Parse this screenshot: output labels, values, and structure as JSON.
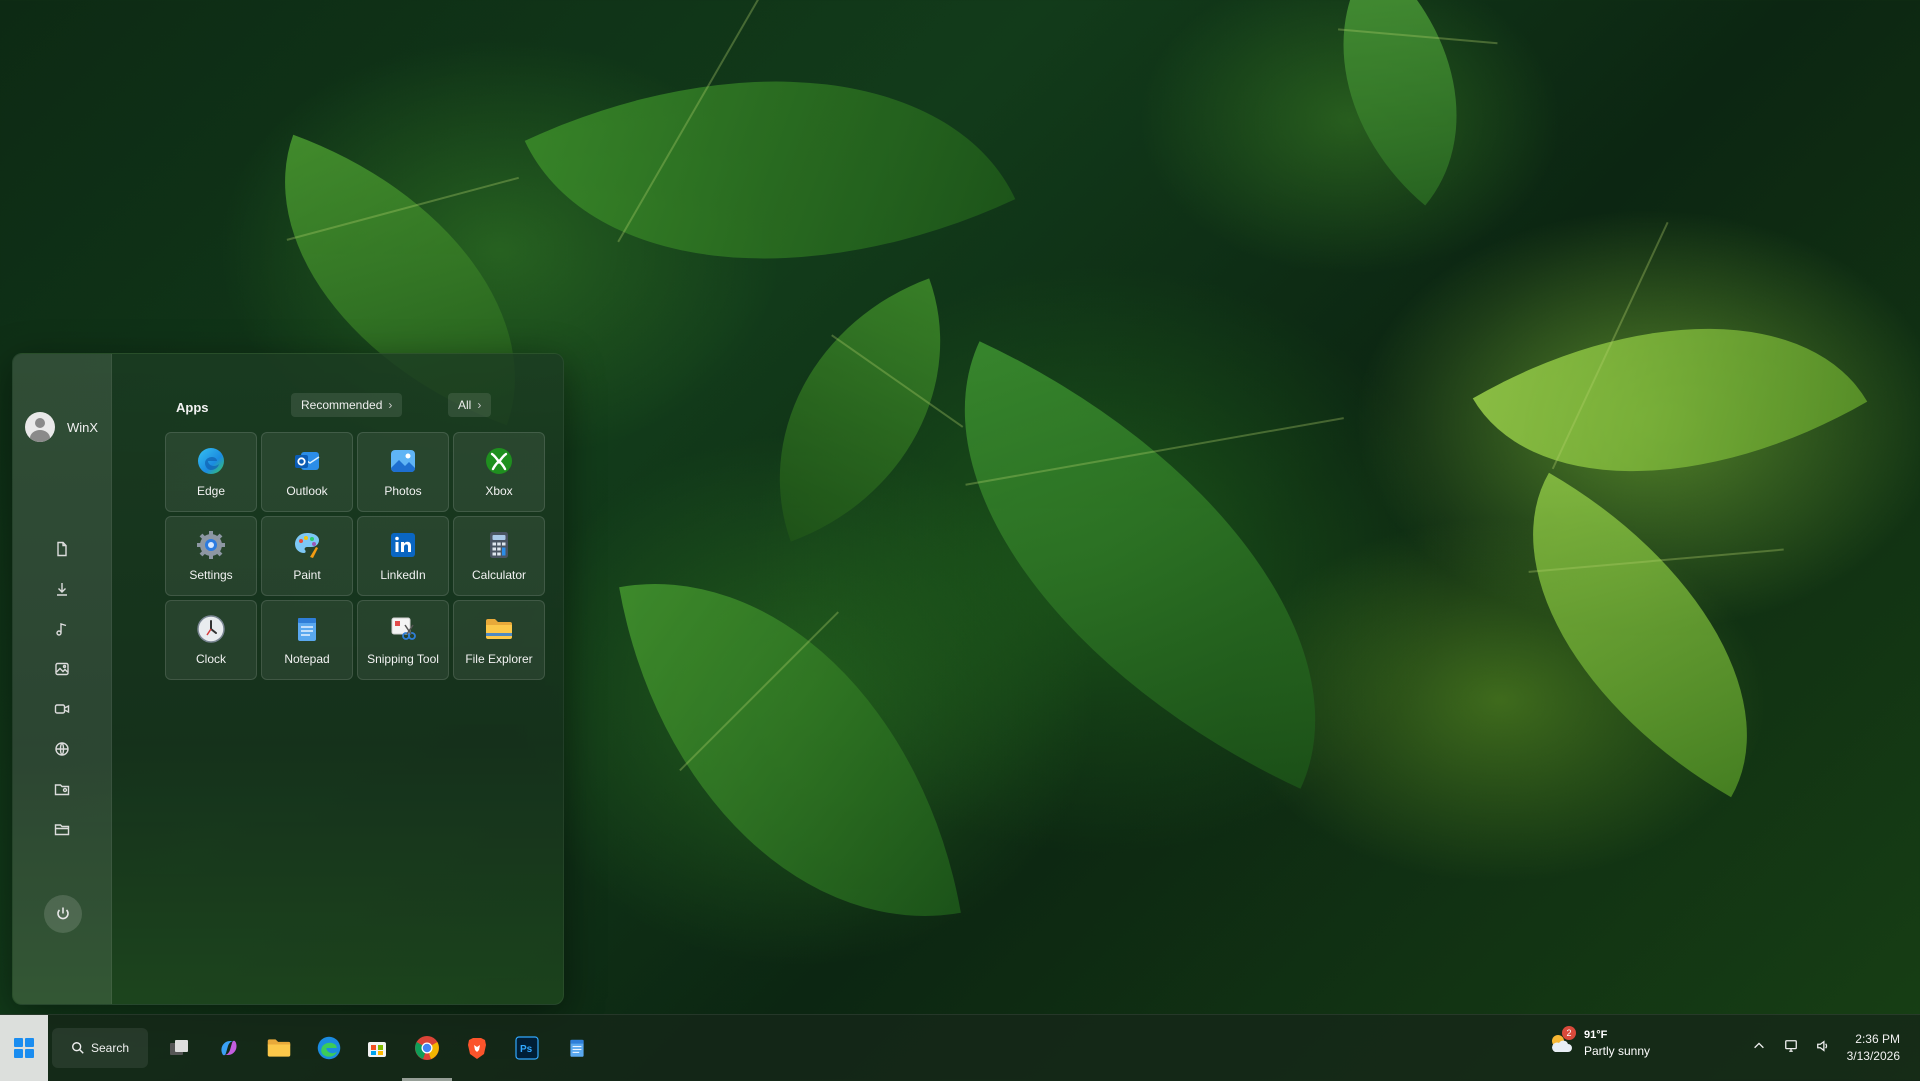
{
  "start_menu": {
    "user": {
      "name": "WinX"
    },
    "apps_heading": "Apps",
    "recommended_label": "Recommended",
    "all_label": "All",
    "apps": [
      {
        "label": "Edge",
        "icon": "edge-icon"
      },
      {
        "label": "Outlook",
        "icon": "outlook-icon"
      },
      {
        "label": "Photos",
        "icon": "photos-icon"
      },
      {
        "label": "Xbox",
        "icon": "xbox-icon"
      },
      {
        "label": "Settings",
        "icon": "settings-icon"
      },
      {
        "label": "Paint",
        "icon": "paint-icon"
      },
      {
        "label": "LinkedIn",
        "icon": "linkedin-icon"
      },
      {
        "label": "Calculator",
        "icon": "calculator-icon"
      },
      {
        "label": "Clock",
        "icon": "clock-icon"
      },
      {
        "label": "Notepad",
        "icon": "notepad-icon"
      },
      {
        "label": "Snipping Tool",
        "icon": "snipping-tool-icon"
      },
      {
        "label": "File Explorer",
        "icon": "file-explorer-icon"
      }
    ],
    "rail_icons": [
      "documents-icon",
      "downloads-icon",
      "music-icon",
      "pictures-icon",
      "videos-icon",
      "network-icon",
      "personal-folder-icon",
      "file-explorer-icon"
    ],
    "power_icon": "power-icon"
  },
  "taskbar": {
    "search_label": "Search",
    "pinned": [
      "task-view-icon",
      "copilot-icon",
      "file-explorer-icon",
      "edge-icon",
      "store-icon",
      "chrome-icon",
      "brave-icon",
      "photoshop-icon",
      "notepad-icon"
    ],
    "active_app": "chrome-icon",
    "weather": {
      "temp": "91°F",
      "condition": "Partly sunny",
      "badge": "2"
    },
    "clock": {
      "time": "2:36 PM",
      "date": "3/13/2026"
    },
    "tray_icons": [
      "chevron-up-icon",
      "network-icon",
      "volume-icon"
    ]
  },
  "colors": {
    "accent": "#1a8df0",
    "glass": "#1c3c22"
  }
}
